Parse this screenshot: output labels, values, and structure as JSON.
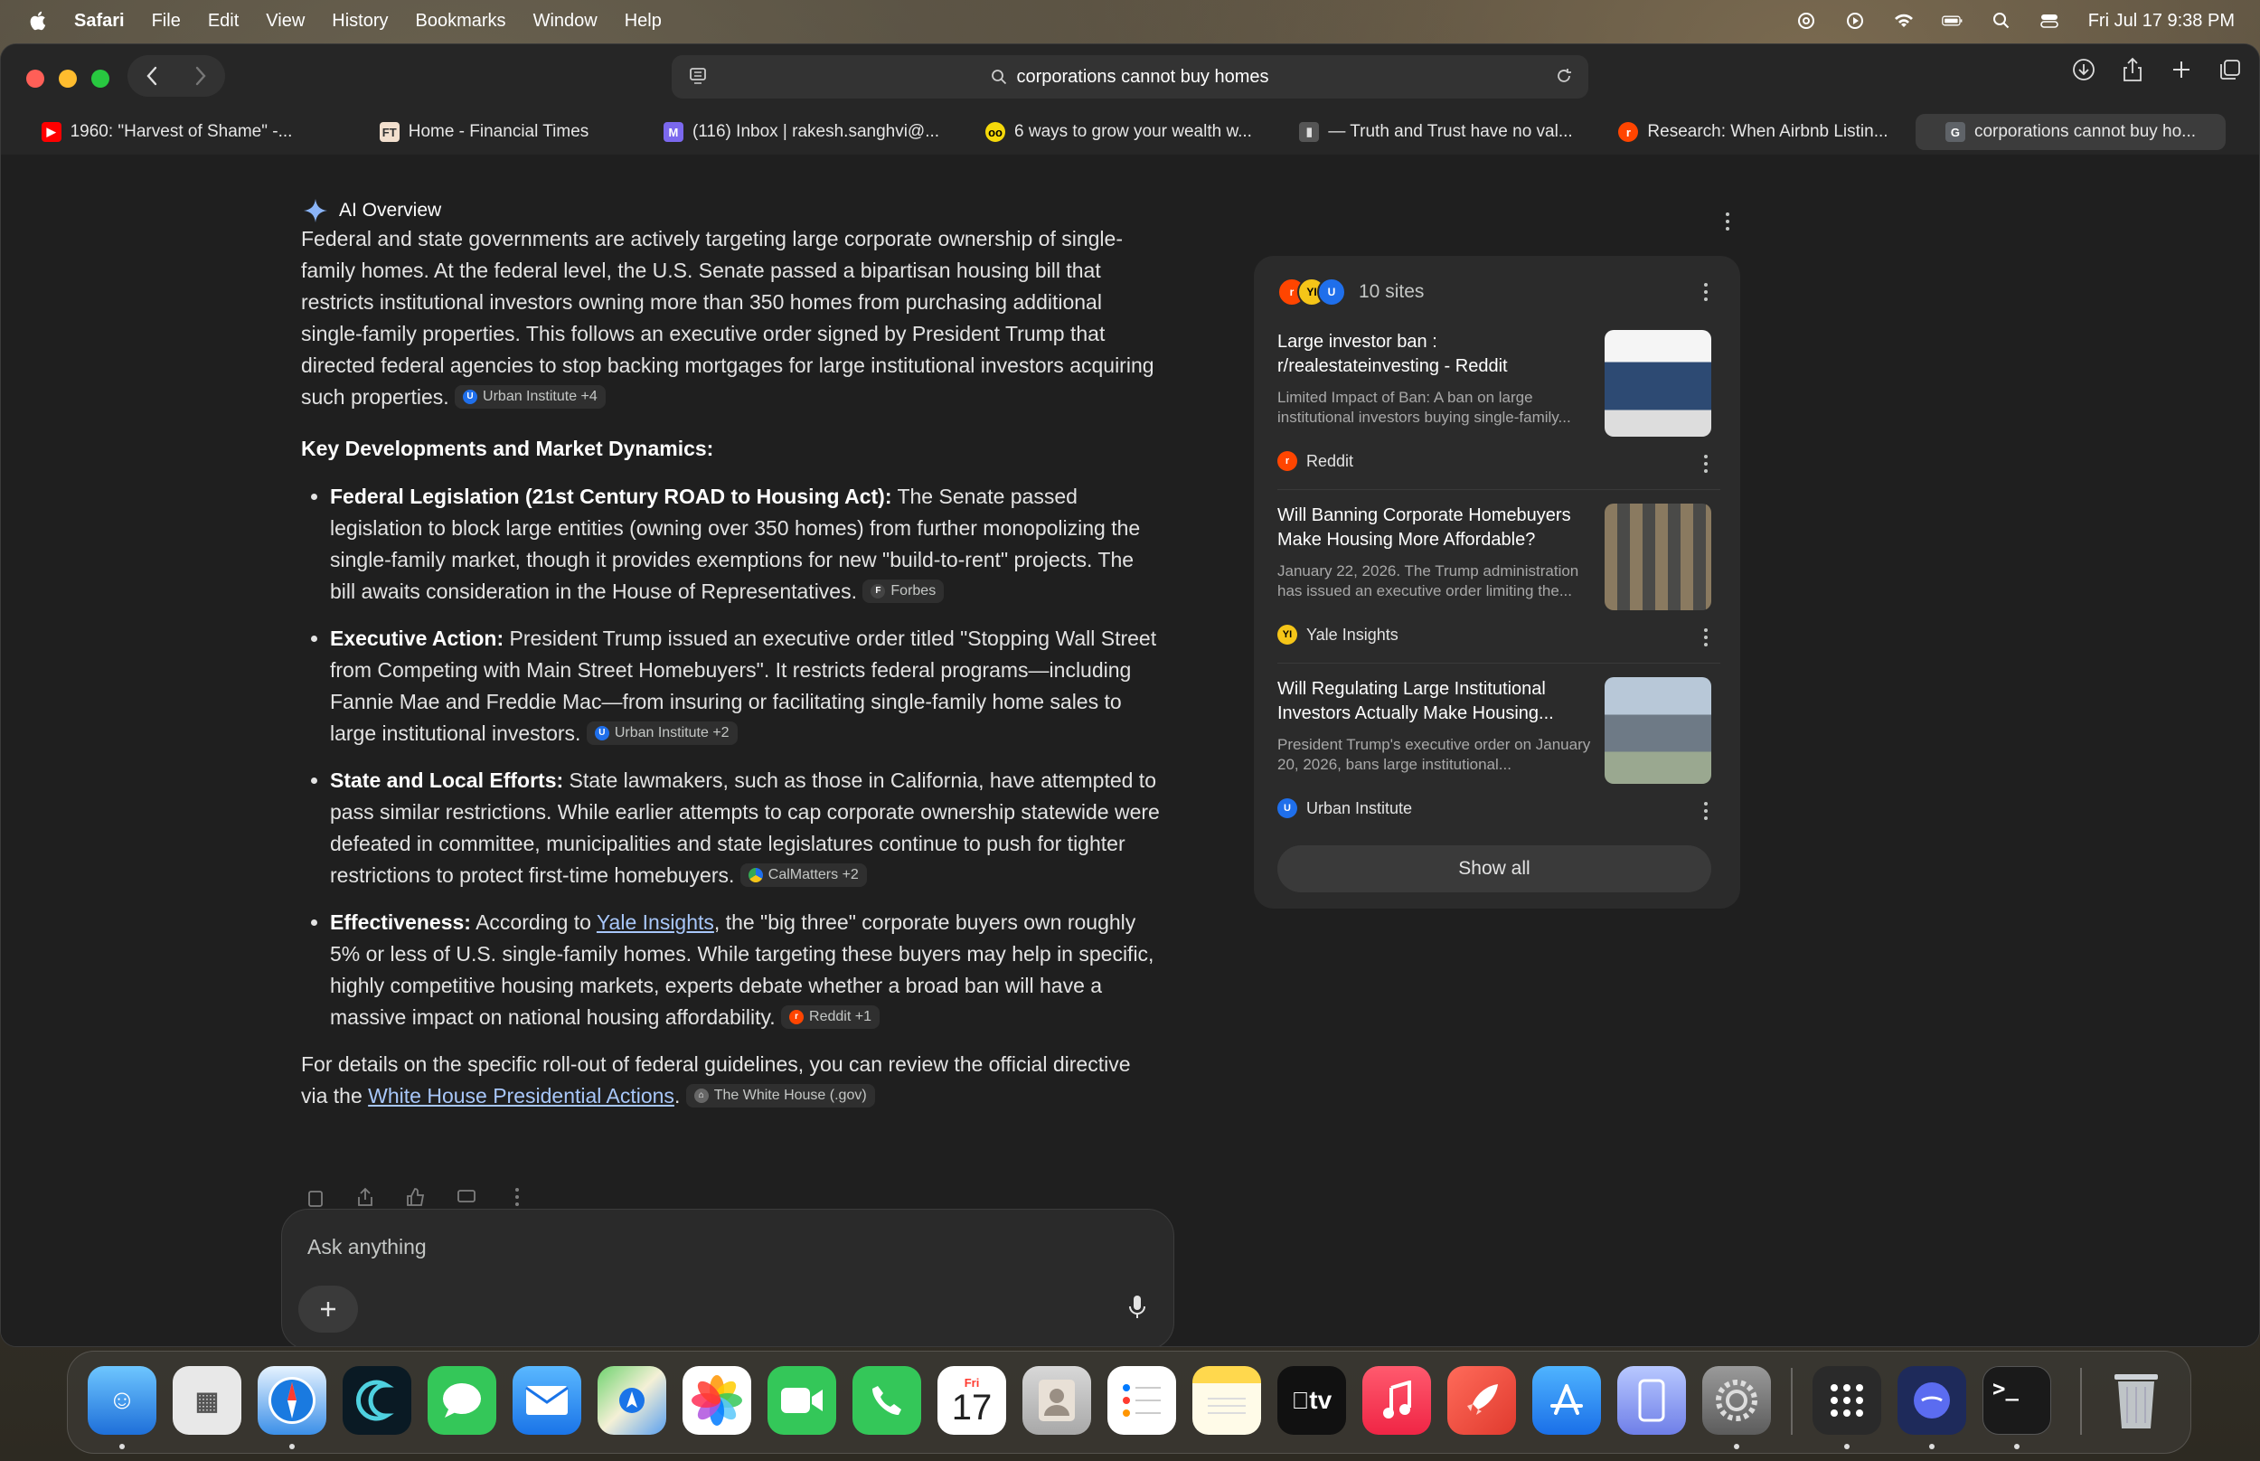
{
  "menubar": {
    "app": "Safari",
    "items": [
      "File",
      "Edit",
      "View",
      "History",
      "Bookmarks",
      "Window",
      "Help"
    ],
    "clock": "Fri Jul 17  9:38 PM"
  },
  "toolbar": {
    "url": "corporations cannot buy homes"
  },
  "tabs": [
    {
      "title": "1960: \"Harvest of Shame\" -...",
      "favicon": "youtube-icon",
      "color": "#ff0000",
      "glyph": "▶"
    },
    {
      "title": "Home - Financial Times",
      "favicon": "ft-icon",
      "color": "#f2dfce",
      "glyph": "FT"
    },
    {
      "title": "(116) Inbox | rakesh.sanghvi@...",
      "favicon": "mail-icon",
      "color": "#7b68ee",
      "glyph": "M"
    },
    {
      "title": "6 ways to grow your wealth w...",
      "favicon": "owl-icon",
      "color": "#f5d90a",
      "glyph": "oo"
    },
    {
      "title": "— Truth and Trust have no val...",
      "favicon": "page-icon",
      "color": "#555",
      "glyph": "▮"
    },
    {
      "title": "Research: When Airbnb Listin...",
      "favicon": "reddit-icon",
      "color": "#ff4500",
      "glyph": "r"
    },
    {
      "title": "corporations cannot buy ho...",
      "favicon": "google-icon",
      "color": "#5f6368",
      "glyph": "G"
    }
  ],
  "ai_overview": {
    "label": "AI Overview",
    "intro": "Federal and state governments are actively targeting large corporate ownership of single-family homes. At the federal level, the U.S. Senate passed a bipartisan housing bill that restricts institutional investors owning more than 350 homes from purchasing additional single-family properties. This follows an executive order signed by President Trump that directed federal agencies to stop backing mortgages for large institutional investors acquiring such properties.",
    "intro_chip": "Urban Institute +4",
    "heading": "Key Developments and Market Dynamics:",
    "bullets": [
      {
        "bold": "Federal Legislation (21st Century ROAD to Housing Act):",
        "text": " The Senate passed legislation to block large entities (owning over 350 homes) from further monopolizing the single-family market, though it provides exemptions for new \"build-to-rent\" projects. The bill awaits consideration in the House of Representatives.",
        "chip": "Forbes"
      },
      {
        "bold": "Executive Action:",
        "text": " President Trump issued an executive order titled \"Stopping Wall Street from Competing with Main Street Homebuyers\". It restricts federal programs—including Fannie Mae and Freddie Mac—from insuring or facilitating single-family home sales to large institutional investors.",
        "chip": "Urban Institute +2"
      },
      {
        "bold": "State and Local Efforts:",
        "text": " State lawmakers, such as those in California, have attempted to pass similar restrictions. While earlier attempts to cap corporate ownership statewide were defeated in committee, municipalities and state legislatures continue to push for tighter restrictions to protect first-time homebuyers.",
        "chip": "CalMatters +2"
      },
      {
        "bold": "Effectiveness:",
        "pre": " According to ",
        "link": "Yale Insights",
        "text": ", the \"big three\" corporate buyers own roughly 5% or less of U.S. single-family homes. While targeting these buyers may help in specific, highly competitive housing markets, experts debate whether a broad ban will have a massive impact on national housing affordability.",
        "chip": "Reddit +1"
      }
    ],
    "closing_pre": "For details on the specific roll-out of federal guidelines, you can review the official directive via the ",
    "closing_link": "White House Presidential Actions",
    "closing_post": ".",
    "closing_chip": "The White House (.gov)"
  },
  "ask": {
    "placeholder": "Ask anything"
  },
  "sources": {
    "count_label": "10 sites",
    "cards": [
      {
        "title": "Large investor ban : r/realestateinvesting - Reddit",
        "snippet": "Limited Impact of Ban: A ban on large institutional investors buying single-family...",
        "source": "Reddit",
        "favcolor": "#ff4500"
      },
      {
        "title": "Will Banning Corporate Homebuyers Make Housing More Affordable?",
        "snippet": "January 22, 2026. The Trump administration has issued an executive order limiting the...",
        "source": "Yale Insights",
        "favcolor": "#f5c518"
      },
      {
        "title": "Will Regulating Large Institutional Investors Actually Make Housing...",
        "snippet": "President Trump's executive order on January 20, 2026, bans large institutional...",
        "source": "Urban Institute",
        "favcolor": "#1f6feb"
      }
    ],
    "show_all": "Show all"
  },
  "dock": {
    "calendar_month": "Fri",
    "calendar_day": "17",
    "tv_label": "tv"
  }
}
